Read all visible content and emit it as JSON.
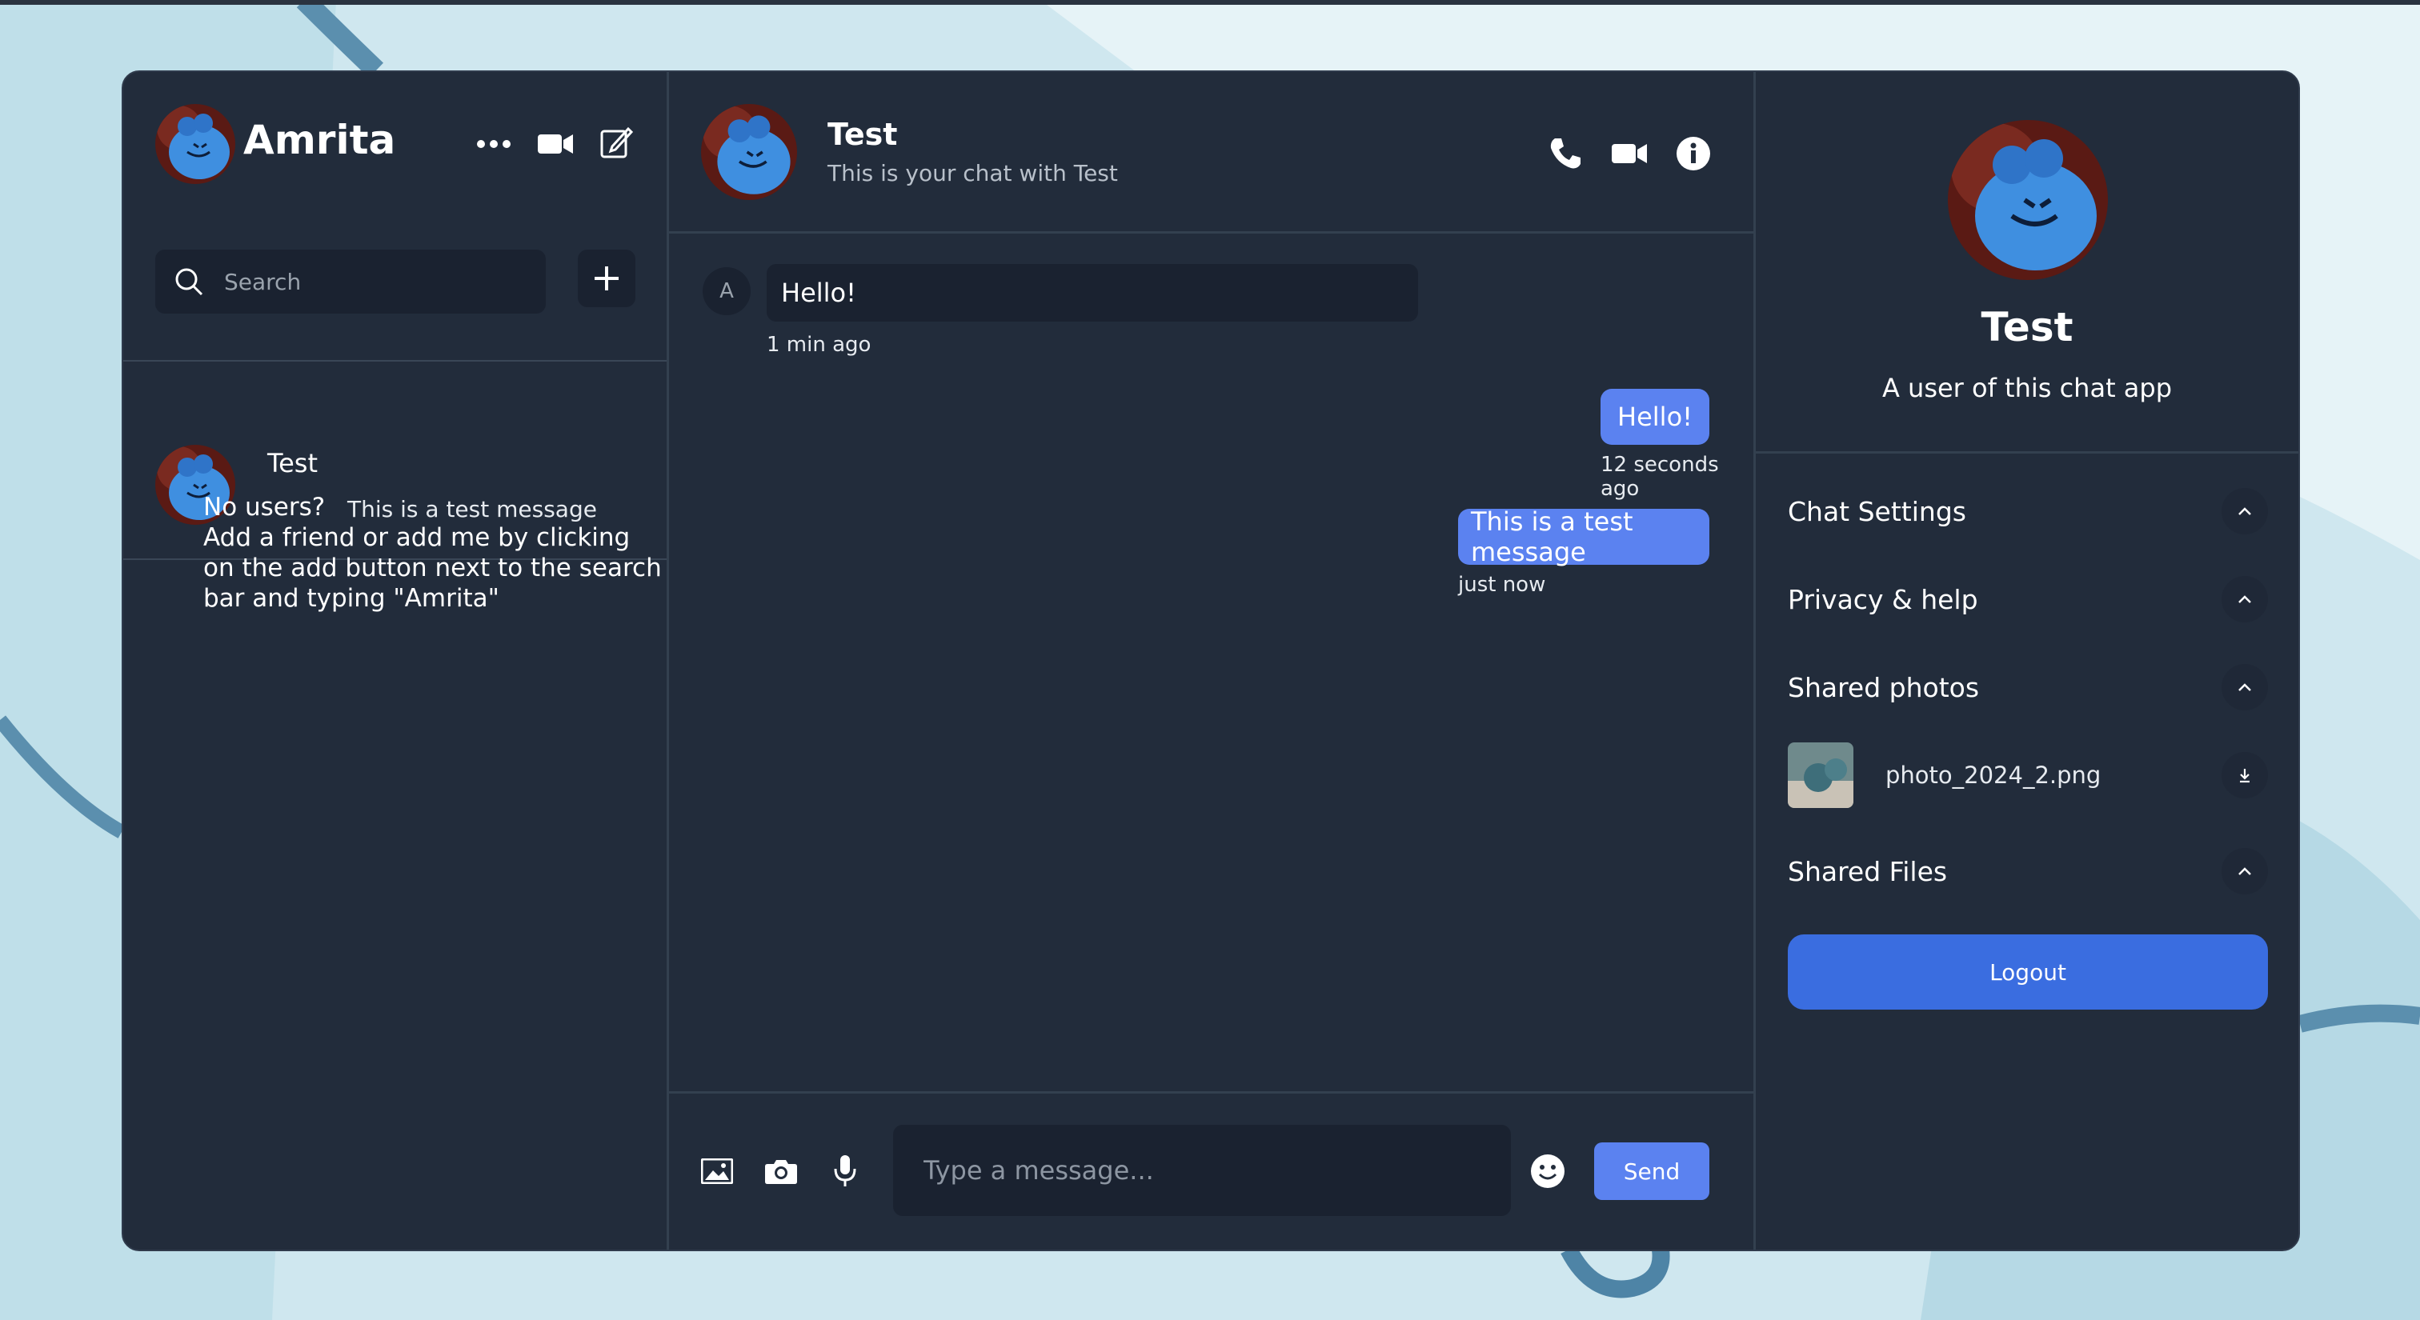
{
  "colors": {
    "panel": "#222c3b",
    "input_bg": "#1a2230",
    "accent": "#5b82f0",
    "logout": "#3a6de0"
  },
  "sidebar": {
    "user_name": "Amrita",
    "icons": [
      "more-icon",
      "video-icon",
      "compose-icon"
    ],
    "search_placeholder": "Search",
    "add_icon": "plus-icon",
    "chats": [
      {
        "name": "Test",
        "preview": "This is a test message"
      }
    ],
    "no_users_title": "No users?",
    "no_users_body": "Add a friend or add me by clicking on the add button next to the search bar and typing \"Amrita\""
  },
  "chat": {
    "title": "Test",
    "subtitle": "This is your chat with Test",
    "header_icons": [
      "phone-icon",
      "video-icon",
      "info-icon"
    ],
    "messages": [
      {
        "sender_initial": "A",
        "text": "Hello!",
        "time": "1 min ago",
        "direction": "in"
      },
      {
        "text": "Hello!",
        "time": "12 seconds ago",
        "direction": "out"
      },
      {
        "text": "This is a test message",
        "time": "just now",
        "direction": "out"
      }
    ],
    "composer": {
      "icons": [
        "image-icon",
        "camera-icon",
        "microphone-icon",
        "emoji-icon"
      ],
      "placeholder": "Type a message...",
      "send_label": "Send"
    }
  },
  "details": {
    "name": "Test",
    "description": "A user of this chat app",
    "sections": [
      {
        "label": "Chat Settings"
      },
      {
        "label": "Privacy & help"
      },
      {
        "label": "Shared photos"
      },
      {
        "label": "Shared Files"
      }
    ],
    "shared_photo": {
      "filename": "photo_2024_2.png"
    },
    "logout_label": "Logout"
  }
}
